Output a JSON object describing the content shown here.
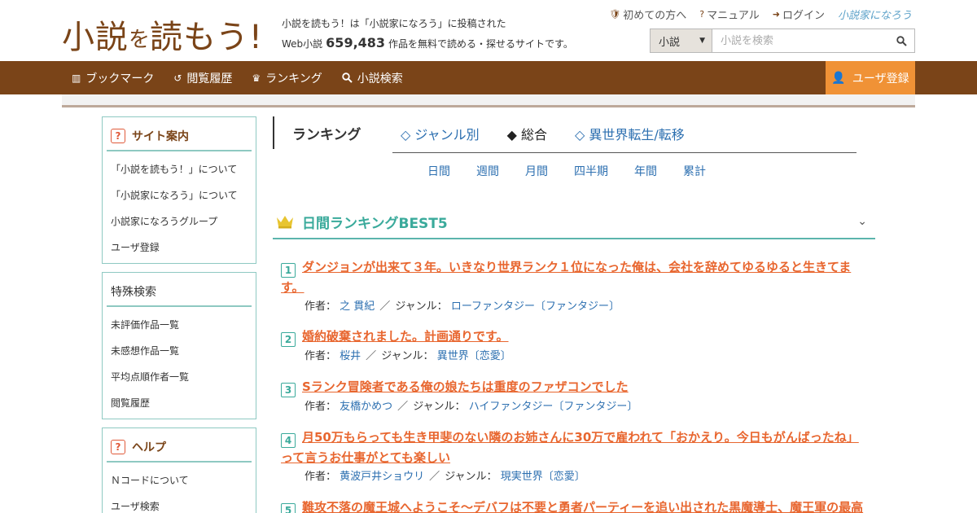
{
  "site": {
    "logo": {
      "part1": "小説",
      "part2": "を",
      "part3": "読もう",
      "part4": "!"
    },
    "tagline_line1": "小説を読もう！は「小説家になろう」に投稿された",
    "tagline_prefix": "Web小説",
    "work_count": "659,483",
    "tagline_suffix": "作品を無料で読める・探せるサイトです。"
  },
  "toplinks": {
    "beginner": "初めての方へ",
    "manual": "マニュアル",
    "login": "ログイン",
    "brand": "小説家になろう"
  },
  "search": {
    "select_value": "小説",
    "placeholder": "小説を検索"
  },
  "nav": {
    "bookmark": "ブックマーク",
    "history": "閲覧履歴",
    "ranking": "ランキング",
    "search": "小説検索",
    "register": "ユーザ登録"
  },
  "sidebar": {
    "guide": {
      "title": "サイト案内",
      "items": [
        "「小説を読もう！」について",
        "「小説家になろう」について",
        "小説家になろうグループ",
        "ユーザ登録"
      ]
    },
    "special": {
      "title": "特殊検索",
      "items": [
        "未評価作品一覧",
        "未感想作品一覧",
        "平均点順作者一覧",
        "閲覧履歴"
      ]
    },
    "help": {
      "title": "ヘルプ",
      "items": [
        "Ｎコードについて",
        "ユーザ検索"
      ]
    }
  },
  "ranking": {
    "title": "ランキング",
    "tabs": [
      "◇ ジャンル別",
      "◆ 総合",
      "◇ 異世界転生/転移"
    ],
    "periods": [
      "日間",
      "週間",
      "月間",
      "四半期",
      "年間",
      "累計"
    ],
    "best_title": "日間ランキングBEST5",
    "author_label": "作者：",
    "genre_label": "ジャンル：",
    "entries": [
      {
        "rank": "1",
        "title": "ダンジョンが出来て３年。いきなり世界ランク１位になった俺は、会社を辞めてゆるゆると生きてます。",
        "author": "之 貫紀",
        "genre": "ローファンタジー〔ファンタジー〕"
      },
      {
        "rank": "2",
        "title": "婚約破棄されました。計画通りです。",
        "author": "桜井",
        "genre": "異世界〔恋愛〕"
      },
      {
        "rank": "3",
        "title": "Sランク冒険者である俺の娘たちは重度のファザコンでした",
        "author": "友橋かめつ",
        "genre": "ハイファンタジー〔ファンタジー〕"
      },
      {
        "rank": "4",
        "title": "月50万もらっても生き甲斐のない隣のお姉さんに30万で雇われて「おかえり。今日もがんばったね」って言うお仕事がとても楽しい",
        "author": "黄波戸井ショウリ",
        "genre": "現実世界〔恋愛〕"
      },
      {
        "rank": "5",
        "title": "難攻不落の魔王城へようこそ～デバフは不要と勇者パーティーを追い出された黒魔導士、魔王軍の最高",
        "author": "",
        "genre": ""
      }
    ]
  }
}
